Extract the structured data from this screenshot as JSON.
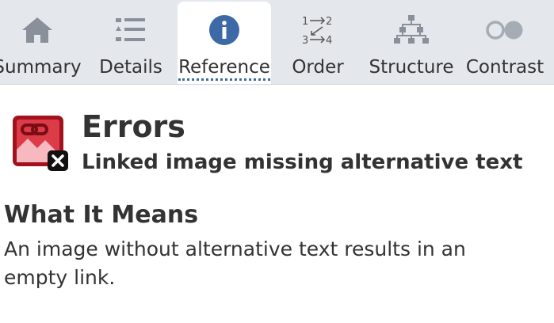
{
  "tabs": [
    {
      "label": "Summary",
      "icon": "home-icon",
      "active": false
    },
    {
      "label": "Details",
      "icon": "list-icon",
      "active": false
    },
    {
      "label": "Reference",
      "icon": "info-icon",
      "active": true
    },
    {
      "label": "Order",
      "icon": "order-icon",
      "active": false
    },
    {
      "label": "Structure",
      "icon": "structure-icon",
      "active": false
    },
    {
      "label": "Contrast",
      "icon": "contrast-icon",
      "active": false
    }
  ],
  "order_icon_text": {
    "top_left": "1",
    "top_right": "2",
    "bottom_left": "3",
    "bottom_right": "4"
  },
  "reference": {
    "category": "Errors",
    "title": "Linked image missing alternative text",
    "icon": "linked-image-error-icon",
    "section_heading": "What It Means",
    "section_body": "An image without alternative text results in an empty link."
  },
  "colors": {
    "tabbar_bg": "#e4e7eb",
    "active_tab_bg": "#ffffff",
    "info_blue": "#3d6aa7",
    "error_red": "#c8202c",
    "icon_gray": "#8a9099",
    "text": "#333333"
  }
}
